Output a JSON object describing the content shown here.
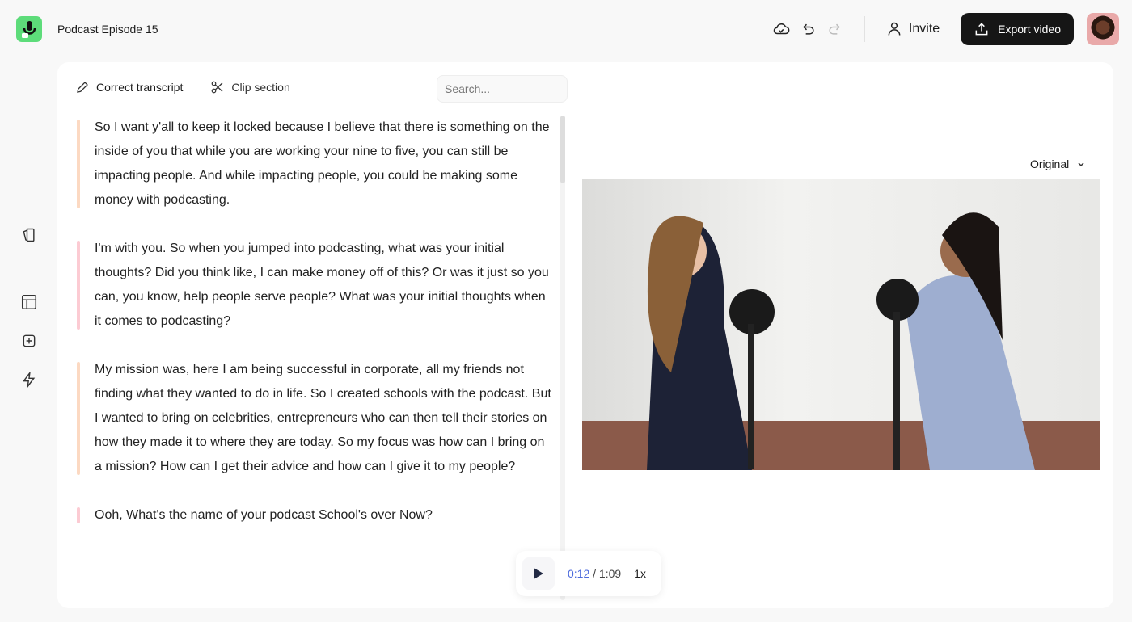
{
  "header": {
    "title": "Podcast Episode 15",
    "invite_label": "Invite",
    "export_label": "Export video"
  },
  "toolbar": {
    "correct_label": "Correct transcript",
    "clip_label": "Clip section",
    "search_placeholder": "Search..."
  },
  "transcript": [
    {
      "text": "So I want y'all to keep it locked because I believe that there is something on the inside of you that while you are working your nine to five, you can still be impacting people. And while impacting people, you could be making some money with podcasting.",
      "color": "#fcd9c2"
    },
    {
      "text": "I'm with you. So when you jumped into podcasting, what was your initial thoughts? Did you think like, I can make money off of this? Or was it just so you can, you know, help people serve people? What was your initial thoughts when it comes to podcasting?",
      "color": "#fccbd3"
    },
    {
      "text": "My mission was, here I am being successful in corporate, all my friends not finding what they wanted to do in life. So I created schools with the podcast. But I wanted to bring on celebrities, entrepreneurs who can then tell their stories on how they made it to where they are today. So my focus was how can I bring on a mission? How can I get their advice and how can I give it to my people?",
      "color": "#fcd9c2"
    },
    {
      "text": "Ooh, What's the name of your podcast School's over Now?",
      "color": "#fccbd3"
    }
  ],
  "video": {
    "aspect_label": "Original"
  },
  "player": {
    "current": "0:12",
    "separator": " / ",
    "duration": "1:09",
    "speed": "1x"
  },
  "colors": {
    "accent": "#4d6bdc",
    "logo": "#5ddc7a",
    "export_bg": "#161616"
  }
}
